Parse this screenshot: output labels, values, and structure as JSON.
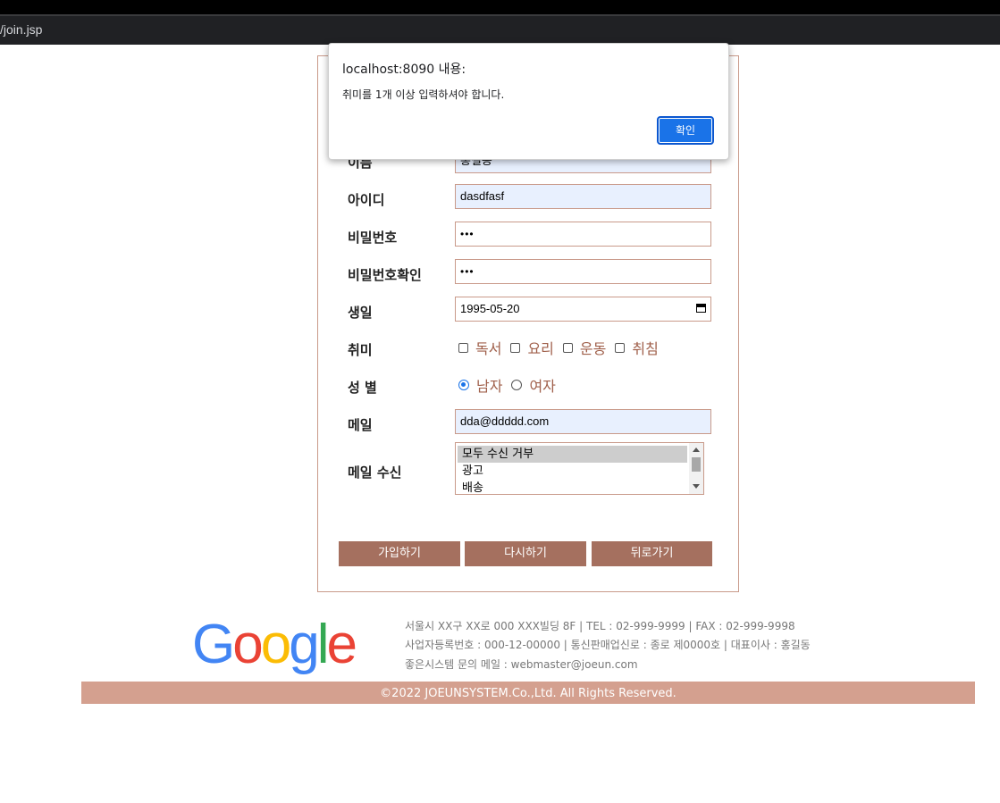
{
  "browser": {
    "url_fragment": "/join.jsp"
  },
  "form": {
    "name": {
      "label": "이름",
      "value": "홍길동"
    },
    "id": {
      "label": "아이디",
      "value": "dasdfasf"
    },
    "pw": {
      "label": "비밀번호",
      "value": "•••"
    },
    "pw_confirm": {
      "label": "비밀번호확인",
      "value": "•••"
    },
    "birthday": {
      "label": "생일",
      "value": "1995-05-20"
    },
    "hobby": {
      "label": "취미",
      "options": [
        "독서",
        "요리",
        "운동",
        "취침"
      ]
    },
    "gender": {
      "label": "성 별",
      "options": [
        "남자",
        "여자"
      ],
      "selected": "남자"
    },
    "email": {
      "label": "메일",
      "value": "dda@ddddd.com"
    },
    "mail_receive": {
      "label": "메일 수신",
      "options": [
        "모두 수신 거부",
        "광고",
        "배송"
      ],
      "selected": "모두 수신 거부"
    },
    "buttons": {
      "join": "가입하기",
      "reset": "다시하기",
      "back": "뒤로가기"
    }
  },
  "footer": {
    "logo": "Google",
    "line1": "서울시 XX구 XX로 000 XXX빌딩 8F | TEL : 02-999-9999 | FAX : 02-999-9998",
    "line2": "사업자등록번호 : 000-12-00000 | 통신판매업신로 : 종로 제0000호 | 대표이사 : 홍길동",
    "line3": "좋은시스템 문의 메일 : webmaster@joeun.com",
    "copyright": "©2022 JOEUNSYSTEM.Co.,Ltd. All Rights Reserved."
  },
  "dialog": {
    "title": "localhost:8090 내용:",
    "message": "취미를 1개 이상 입력하셔야 합니다.",
    "ok": "확인"
  },
  "colors": {
    "accent": "#a5705f",
    "border": "#c99a8a",
    "footer_bar": "#d4a08f",
    "dialog_button": "#1a73e8"
  }
}
